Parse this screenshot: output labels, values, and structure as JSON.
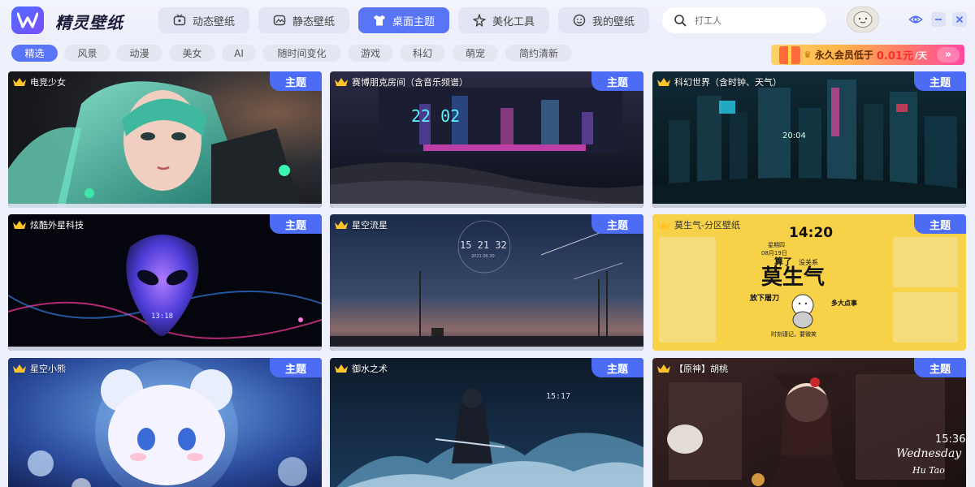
{
  "app": {
    "title": "精灵壁纸"
  },
  "nav": [
    {
      "label": "动态壁纸",
      "icon": "tv-icon"
    },
    {
      "label": "静态壁纸",
      "icon": "image-icon"
    },
    {
      "label": "桌面主题",
      "icon": "shirt-icon",
      "active": true
    },
    {
      "label": "美化工具",
      "icon": "sparkle-icon"
    },
    {
      "label": "我的壁纸",
      "icon": "smile-icon"
    }
  ],
  "search": {
    "placeholder": "打工人"
  },
  "categories": [
    "精选",
    "风景",
    "动漫",
    "美女",
    "AI",
    "随时间变化",
    "游戏",
    "科幻",
    "萌宠",
    "简约清新"
  ],
  "promo": {
    "text": "永久会员低于",
    "price": "0.01元",
    "unit": "/天",
    "arrow": "»"
  },
  "cards": [
    {
      "title": "电竞少女",
      "badge": "主题"
    },
    {
      "title": "赛博朋克房间（含音乐频谱）",
      "badge": "主题",
      "clock": "22 02"
    },
    {
      "title": "科幻世界（含时钟、天气）",
      "badge": "主题",
      "clock": "20:04"
    },
    {
      "title": "炫酷外星科技",
      "badge": "主题",
      "clock": "13:18"
    },
    {
      "title": "星空流星",
      "badge": "主题",
      "clock": "15 21 32",
      "date": "2021.06.30"
    },
    {
      "title": "莫生气-分区壁纸",
      "badge": "主题",
      "clock": "14:20",
      "headline": "莫生气",
      "lines": [
        "星期四",
        "08月19日",
        "算了",
        "没关系",
        "放下屠刀",
        "多大点事",
        "时刻谨记，要微笑"
      ]
    },
    {
      "title": "星空小熊",
      "badge": "主题"
    },
    {
      "title": "御水之术",
      "badge": "主题",
      "clock": "15:17"
    },
    {
      "title": "【原神】胡桃",
      "badge": "主题",
      "clock": "15:36",
      "day": "Wednesday",
      "name": "Hu Tao"
    }
  ]
}
